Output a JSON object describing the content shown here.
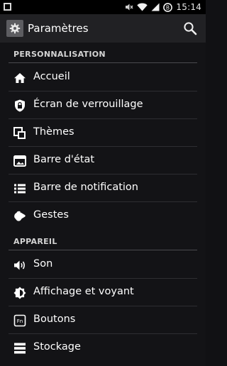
{
  "status_bar": {
    "time": "15:14",
    "battery_level": "B"
  },
  "action_bar": {
    "title": "Paramètres"
  },
  "sections": [
    {
      "header": "PERSONNALISATION",
      "items": [
        {
          "label": "Accueil",
          "icon": "home-icon"
        },
        {
          "label": "Écran de verrouillage",
          "icon": "lock-icon"
        },
        {
          "label": "Thèmes",
          "icon": "themes-icon"
        },
        {
          "label": "Barre d'état",
          "icon": "status-bar-icon"
        },
        {
          "label": "Barre de notification",
          "icon": "notification-list-icon"
        },
        {
          "label": "Gestes",
          "icon": "gestures-icon"
        }
      ]
    },
    {
      "header": "APPAREIL",
      "items": [
        {
          "label": "Son",
          "icon": "speaker-icon"
        },
        {
          "label": "Affichage et voyant",
          "icon": "brightness-icon"
        },
        {
          "label": "Boutons",
          "icon": "buttons-icon"
        },
        {
          "label": "Stockage",
          "icon": "storage-icon"
        }
      ]
    }
  ]
}
